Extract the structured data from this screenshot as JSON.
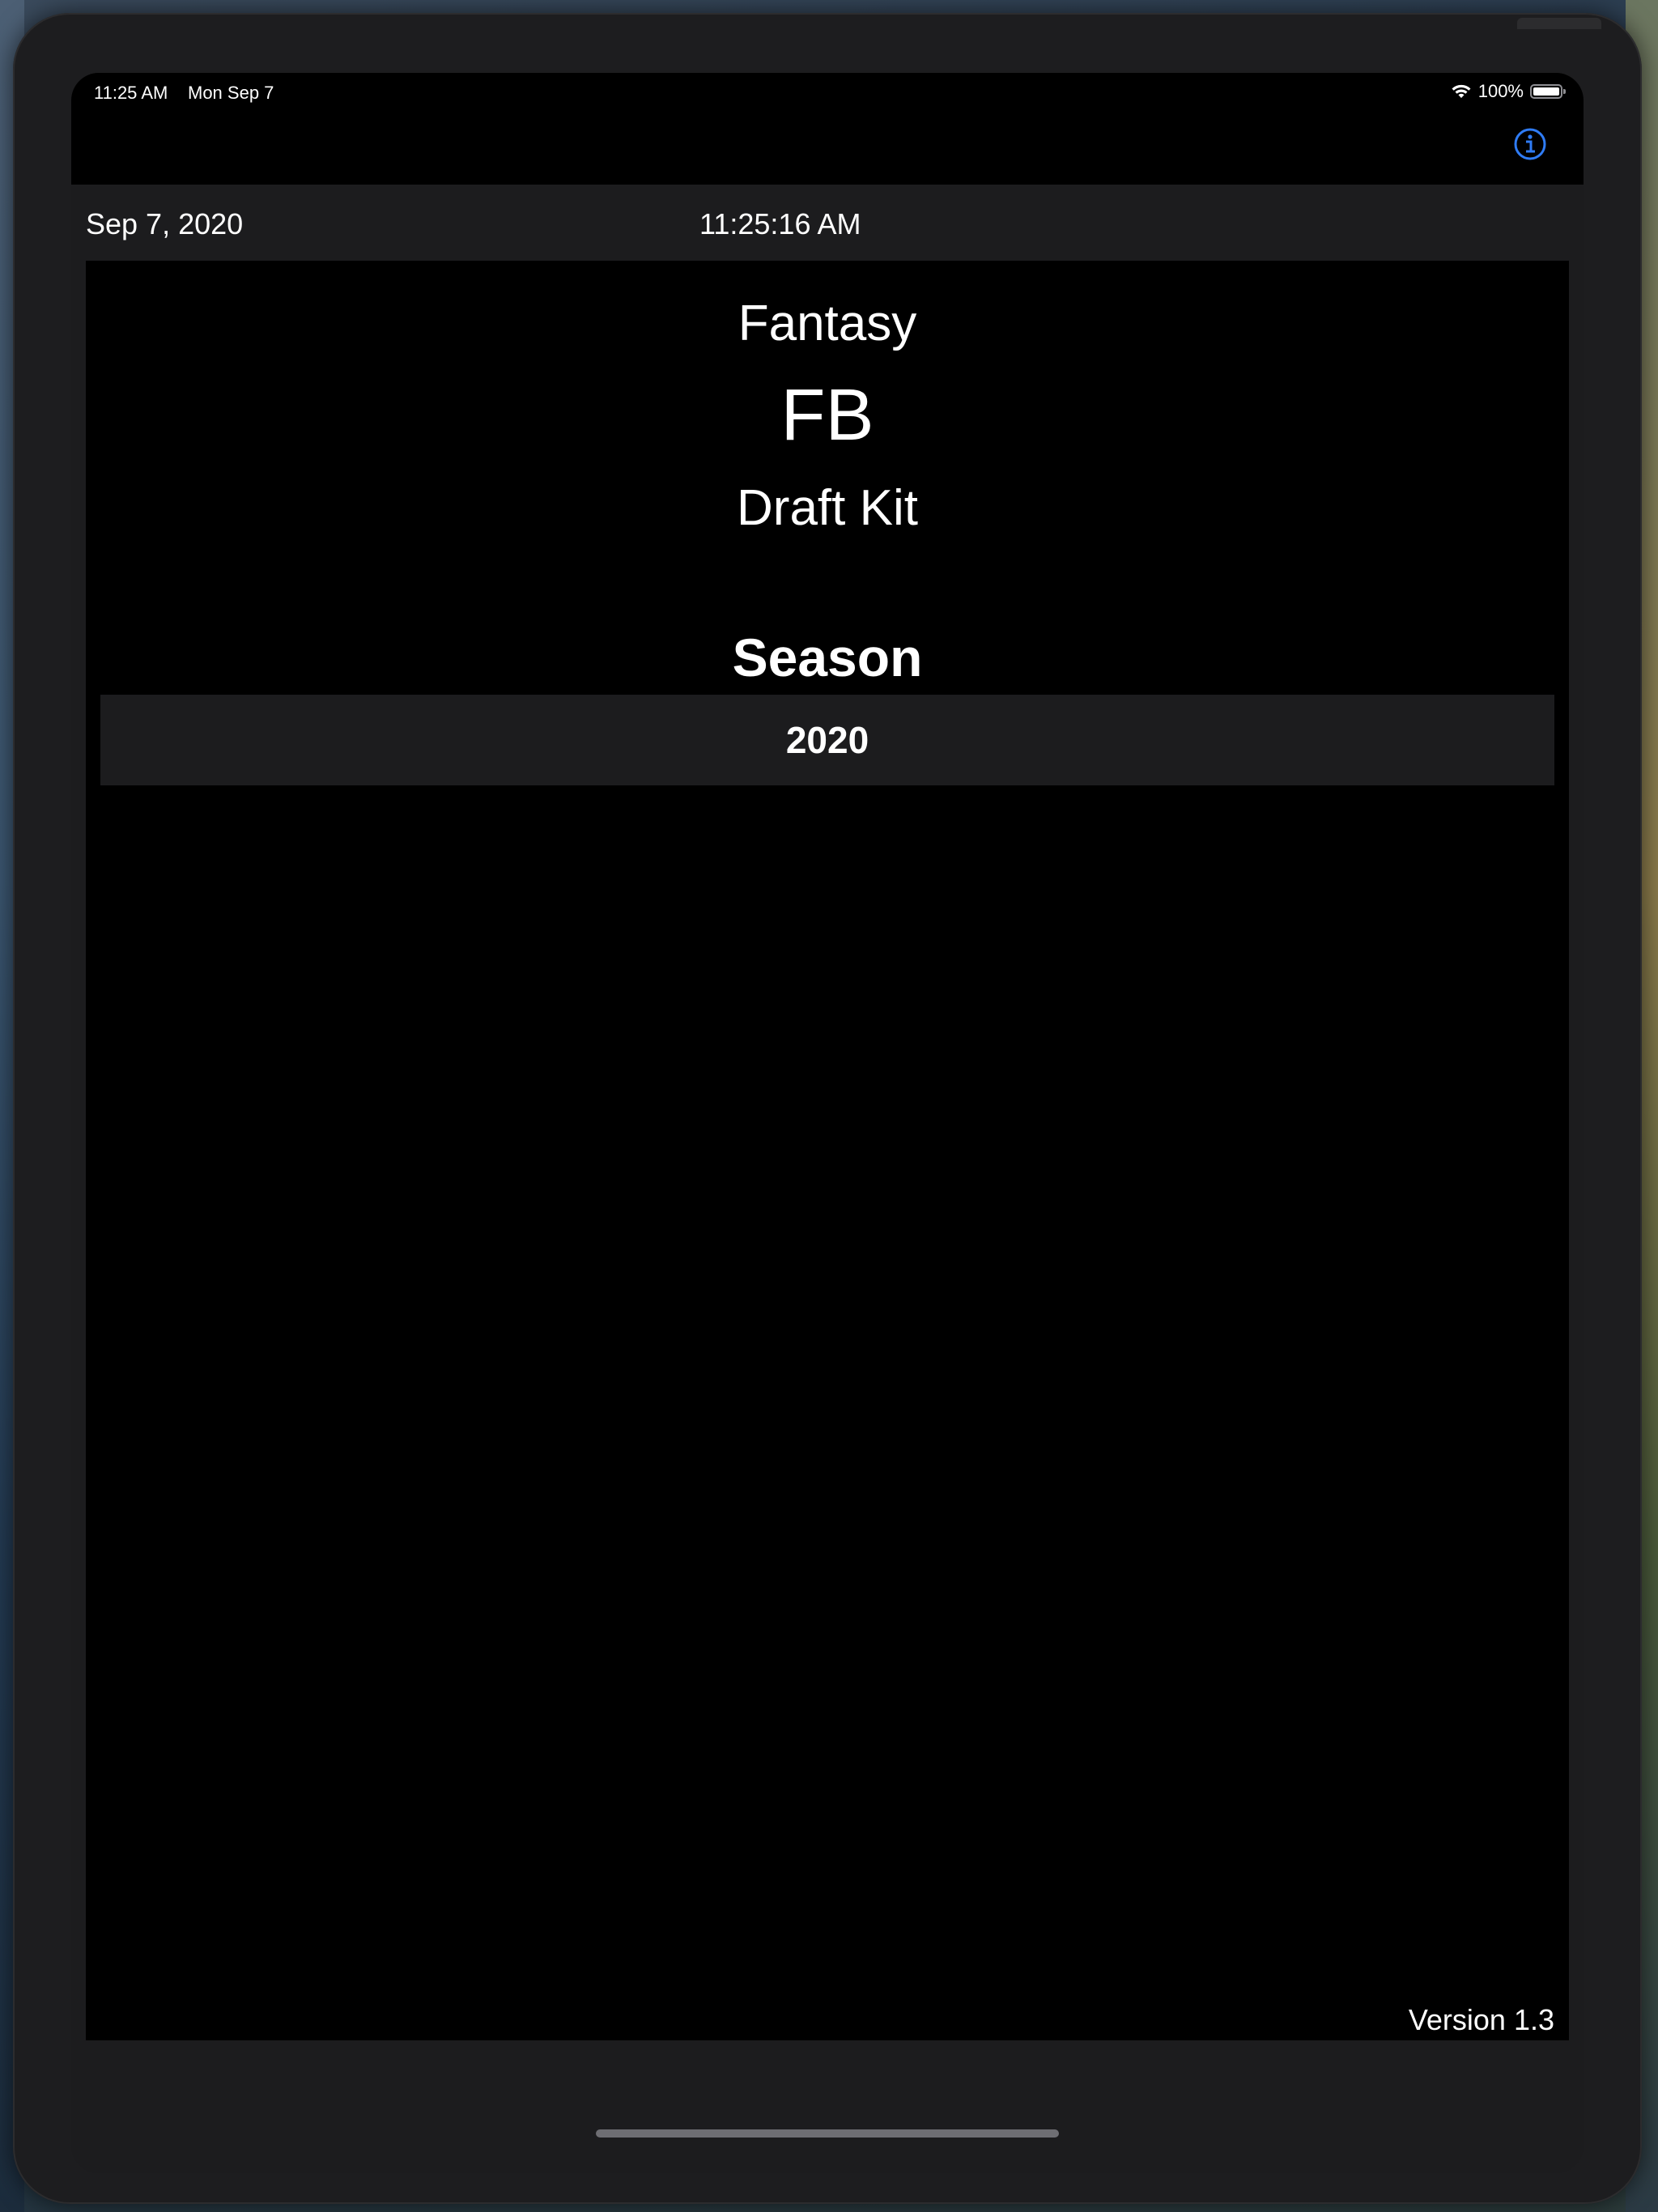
{
  "status_bar": {
    "time": "11:25 AM",
    "date": "Mon Sep 7",
    "battery_percent": "100%",
    "battery_level": 1.0,
    "wifi_icon": "wifi-icon",
    "battery_icon": "battery-icon"
  },
  "nav_bar": {
    "info_icon": "info-circle-icon",
    "accent_color": "#2f7cf6"
  },
  "header": {
    "date": "Sep 7, 2020",
    "time": "11:25:16 AM"
  },
  "title": {
    "line1": "Fantasy",
    "line2": "FB",
    "line3": "Draft Kit"
  },
  "season": {
    "heading": "Season",
    "selected": "2020"
  },
  "footer": {
    "version": "Version 1.3"
  },
  "colors": {
    "background": "#000000",
    "bezel": "#1d1d1f",
    "row_background": "#1c1c1e",
    "text": "#ffffff"
  }
}
